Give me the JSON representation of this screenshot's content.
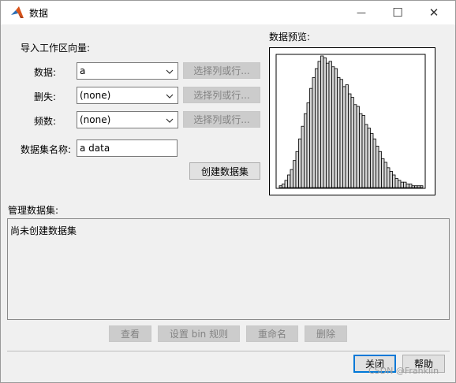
{
  "window": {
    "title": "数据",
    "minimize_glyph": "—",
    "maximize_glyph": "☐",
    "close_glyph": "✕"
  },
  "import": {
    "heading": "导入工作区向量:",
    "rows": [
      {
        "label": "数据:",
        "value": "a",
        "pick_label": "选择列或行..."
      },
      {
        "label": "删失:",
        "value": "(none)",
        "pick_label": "选择列或行..."
      },
      {
        "label": "频数:",
        "value": "(none)",
        "pick_label": "选择列或行..."
      }
    ],
    "name_label": "数据集名称:",
    "name_value": "a data",
    "create_label": "创建数据集"
  },
  "preview": {
    "label": "数据预览:",
    "chart_data": {
      "type": "bar",
      "title": "",
      "xlabel": "",
      "ylabel": "",
      "values": [
        1,
        2,
        4,
        7,
        10,
        15,
        20,
        27,
        34,
        41,
        47,
        55,
        61,
        66,
        70,
        73,
        72,
        69,
        70,
        67,
        66,
        61,
        60,
        56,
        57,
        52,
        50,
        46,
        45,
        41,
        40,
        35,
        33,
        30,
        27,
        23,
        20,
        16,
        14,
        11,
        9,
        7,
        5,
        4,
        3,
        3,
        2,
        2,
        1,
        1,
        1,
        1
      ]
    }
  },
  "manage": {
    "heading": "管理数据集:",
    "empty_text": "尚未创建数据集",
    "buttons": [
      "查看",
      "设置 bin 规则",
      "重命名",
      "删除"
    ]
  },
  "footer": {
    "close_label": "关闭",
    "help_label": "帮助"
  },
  "watermark": "CSDN @Franklin",
  "colors": {
    "bar_fill": "#d4d4d4",
    "bar_stroke": "#000000",
    "focus_border": "#0078d7"
  }
}
